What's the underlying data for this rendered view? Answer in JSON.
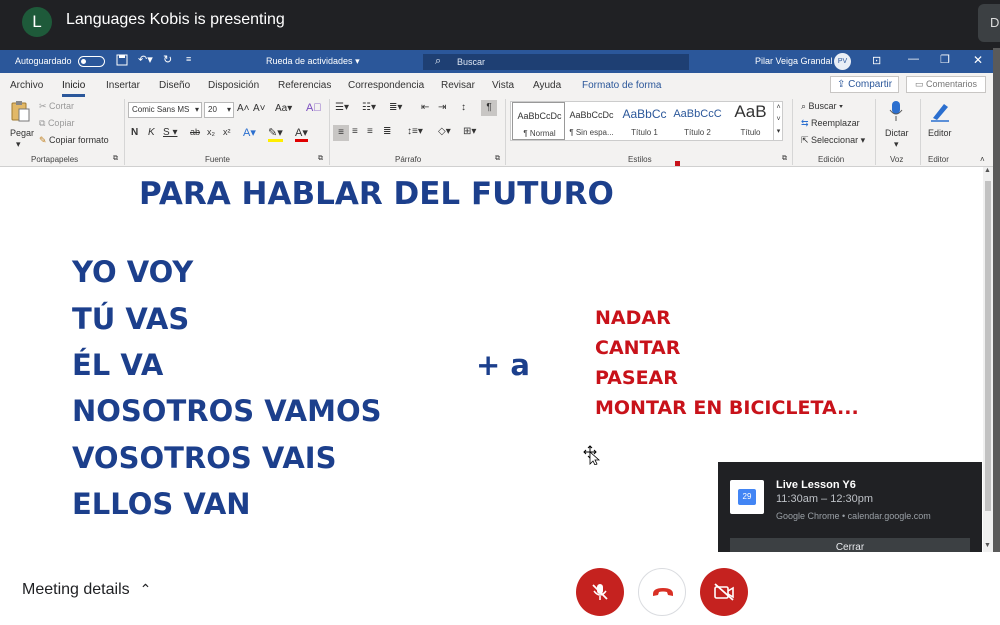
{
  "meet": {
    "avatar_letter": "L",
    "presenting_text": "Languages Kobis is presenting",
    "corner_letter": "D",
    "meeting_details": "Meeting details"
  },
  "word": {
    "autosave_label": "Autoguardado",
    "doc_title": "Rueda de actividades",
    "search_placeholder": "Buscar",
    "user_name": "Pilar Veiga Grandal",
    "user_initials": "PV",
    "tabs": [
      "Archivo",
      "Inicio",
      "Insertar",
      "Diseño",
      "Disposición",
      "Referencias",
      "Correspondencia",
      "Revisar",
      "Vista",
      "Ayuda",
      "Formato de forma"
    ],
    "share_label": "Compartir",
    "comments_label": "Comentarios",
    "clipboard": {
      "paste": "Pegar",
      "cut": "Cortar",
      "copy": "Copiar",
      "format_painter": "Copiar formato",
      "group": "Portapapeles"
    },
    "font": {
      "name": "Comic Sans MS",
      "size": "20",
      "group": "Fuente"
    },
    "paragraph_group": "Párrafo",
    "styles": {
      "items": [
        {
          "sample": "AaBbCcDc",
          "name": "¶ Normal"
        },
        {
          "sample": "AaBbCcDc",
          "name": "¶ Sin espa..."
        },
        {
          "sample": "AaBbCc",
          "name": "Título 1"
        },
        {
          "sample": "AaBbCcC",
          "name": "Título 2"
        },
        {
          "sample": "AaB",
          "name": "Título"
        }
      ],
      "group": "Estilos"
    },
    "editing": {
      "find": "Buscar",
      "replace": "Reemplazar",
      "select": "Seleccionar",
      "group": "Edición"
    },
    "voice": {
      "dictate": "Dictar",
      "group": "Voz"
    },
    "editor": {
      "label": "Editor",
      "group": "Editor"
    }
  },
  "document": {
    "heading": "PARA HABLAR DEL FUTURO",
    "subjects": [
      "YO VOY",
      "TÚ VAS",
      "ÉL VA",
      "NOSOTROS VAMOS",
      "VOSOTROS VAIS",
      "ELLOS VAN"
    ],
    "connector": "+ a",
    "verbs": [
      "NADAR",
      "CANTAR",
      "PASEAR",
      "MONTAR EN BICICLETA..."
    ]
  },
  "notification": {
    "title": "Live Lesson Y6",
    "time": "11:30am – 12:30pm",
    "source": "Google Chrome • calendar.google.com",
    "calendar_day": "29",
    "close_label": "Cerrar"
  }
}
